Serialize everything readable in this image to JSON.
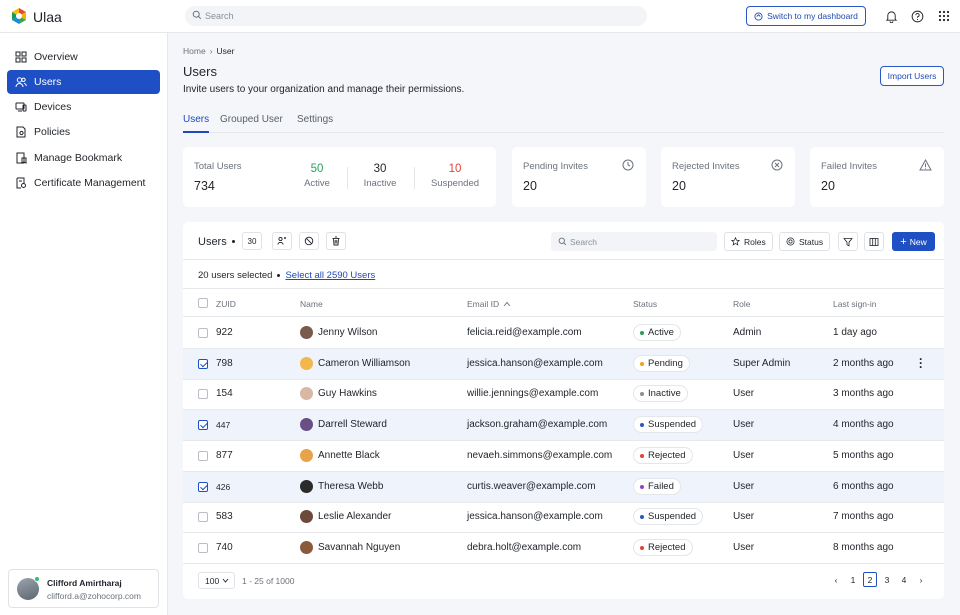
{
  "app": {
    "name": "Ulaa"
  },
  "topbar": {
    "search_placeholder": "Search",
    "switch_label": "Switch to my dashboard",
    "icons": [
      "bell-icon",
      "help-icon",
      "apps-grid-icon"
    ]
  },
  "sidebar": {
    "items": [
      {
        "label": "Overview",
        "icon": "grid-icon",
        "active": false
      },
      {
        "label": "Users",
        "icon": "users-icon",
        "active": true
      },
      {
        "label": "Devices",
        "icon": "device-icon",
        "active": false
      },
      {
        "label": "Policies",
        "icon": "policy-icon",
        "active": false
      },
      {
        "label": "Manage Bookmark",
        "icon": "bookmark-icon",
        "active": false
      },
      {
        "label": "Certificate Management",
        "icon": "certificate-icon",
        "active": false
      }
    ],
    "user": {
      "name": "Clifford Amirtharaj",
      "email": "clifford.a@zohocorp.com"
    }
  },
  "breadcrumb": {
    "home": "Home",
    "current": "User"
  },
  "header": {
    "title": "Users",
    "subtitle": "Invite users to your organization and manage their permissions.",
    "import_label": "Import Users"
  },
  "tabs": [
    {
      "label": "Users",
      "active": true
    },
    {
      "label": "Grouped User",
      "active": false
    },
    {
      "label": "Settings",
      "active": false
    }
  ],
  "stats": {
    "total": {
      "label": "Total Users",
      "value": "734"
    },
    "active": {
      "value": "50",
      "label": "Active",
      "color": "#2a9d5c"
    },
    "inactive": {
      "value": "30",
      "label": "Inactive"
    },
    "suspended": {
      "value": "10",
      "label": "Suspended",
      "color": "#e0433a"
    },
    "pending": {
      "label": "Pending Invites",
      "value": "20",
      "icon": "clock-icon"
    },
    "rejected": {
      "label": "Rejected Invites",
      "value": "20",
      "icon": "x-circle-icon"
    },
    "failed": {
      "label": "Failed Invites",
      "value": "20",
      "icon": "warning-icon"
    }
  },
  "table": {
    "title": "Users",
    "count": "30",
    "search_placeholder": "Search",
    "roles_label": "Roles",
    "status_label": "Status",
    "new_label": "New",
    "selection": {
      "text": "20 users selected",
      "select_all": "Select all 2590 Users"
    },
    "columns": [
      "ZUID",
      "Name",
      "Email ID",
      "Status",
      "Role",
      "Last sign-in"
    ],
    "rows": [
      {
        "zuid": "922",
        "name": "Jenny Wilson",
        "email": "felicia.reid@example.com",
        "status": "Active",
        "dot": "#2a9d5c",
        "role": "Admin",
        "last": "1 day ago",
        "checked": false,
        "av": "#7a5a4a"
      },
      {
        "zuid": "798",
        "name": "Cameron Williamson",
        "email": "jessica.hanson@example.com",
        "status": "Pending",
        "dot": "#f0a21a",
        "role": "Super Admin",
        "last": "2 months ago",
        "checked": true,
        "av": "#f2b84b"
      },
      {
        "zuid": "154",
        "name": "Guy Hawkins",
        "email": "willie.jennings@example.com",
        "status": "Inactive",
        "dot": "#8a9099",
        "role": "User",
        "last": "3 months ago",
        "checked": false,
        "av": "#d8b8a4"
      },
      {
        "zuid": "447",
        "name": "Darrell Steward",
        "email": "jackson.graham@example.com",
        "status": "Suspended",
        "dot": "#2a56c6",
        "role": "User",
        "last": "4 months ago",
        "checked": true,
        "av": "#6a4f86"
      },
      {
        "zuid": "877",
        "name": "Annette Black",
        "email": "nevaeh.simmons@example.com",
        "status": "Rejected",
        "dot": "#e0433a",
        "role": "User",
        "last": "5 months ago",
        "checked": false,
        "av": "#e8a24a"
      },
      {
        "zuid": "426",
        "name": "Theresa Webb",
        "email": "curtis.weaver@example.com",
        "status": "Failed",
        "dot": "#8e44c9",
        "role": "User",
        "last": "6 months ago",
        "checked": true,
        "av": "#2b2b2b"
      },
      {
        "zuid": "583",
        "name": "Leslie Alexander",
        "email": "jessica.hanson@example.com",
        "status": "Suspended",
        "dot": "#2a56c6",
        "role": "User",
        "last": "7 months ago",
        "checked": false,
        "av": "#6b4a3c"
      },
      {
        "zuid": "740",
        "name": "Savannah Nguyen",
        "email": "debra.holt@example.com",
        "status": "Rejected",
        "dot": "#e0433a",
        "role": "User",
        "last": "8 months ago",
        "checked": false,
        "av": "#8a5a3a"
      }
    ],
    "footer": {
      "per_page": "100",
      "range": "1 - 25 of 1000",
      "pages": [
        "1",
        "2",
        "3",
        "4"
      ],
      "current_page": "2"
    }
  }
}
